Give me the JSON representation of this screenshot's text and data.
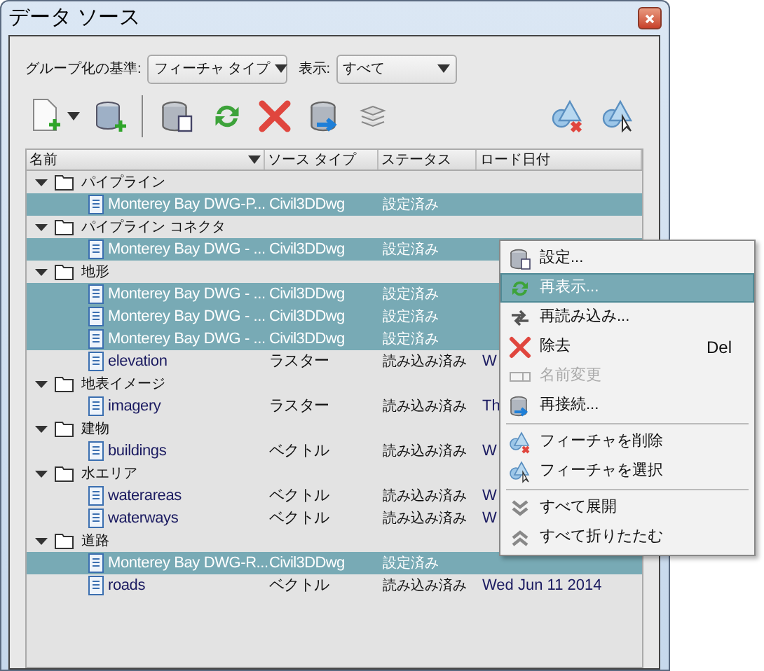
{
  "window": {
    "title": "データ ソース"
  },
  "filters": [
    {
      "label": "グループ化の基準:",
      "value": "フィーチャ タイプ"
    },
    {
      "label": "表示:",
      "value": "すべて"
    }
  ],
  "table": {
    "columns": [
      "名前",
      "ソース タイプ",
      "ステータス",
      "ロード日付"
    ],
    "groups": [
      {
        "name": "パイプライン",
        "expanded": true,
        "children": [
          {
            "name": "Monterey Bay DWG-P...",
            "source_type": "Civil3DDwg",
            "status": "設定済み",
            "selected": true
          }
        ]
      },
      {
        "name": "パイプライン コネクタ",
        "expanded": true,
        "children": [
          {
            "name": "Monterey Bay DWG - ...",
            "source_type": "Civil3DDwg",
            "status": "設定済み",
            "selected": true
          }
        ]
      },
      {
        "name": "地形",
        "expanded": true,
        "children": [
          {
            "name": "Monterey Bay DWG - ...",
            "source_type": "Civil3DDwg",
            "status": "設定済み",
            "selected": true
          },
          {
            "name": "Monterey Bay DWG - ...",
            "source_type": "Civil3DDwg",
            "status": "設定済み",
            "selected": true
          },
          {
            "name": "Monterey Bay DWG - ...",
            "source_type": "Civil3DDwg",
            "status": "設定済み",
            "selected": true
          },
          {
            "name": "elevation",
            "source_type": "ラスター",
            "status": "読み込み済み",
            "date": "W",
            "selected": false
          }
        ]
      },
      {
        "name": "地表イメージ",
        "expanded": true,
        "children": [
          {
            "name": "imagery",
            "source_type": "ラスター",
            "status": "読み込み済み",
            "date": "Th",
            "selected": false
          }
        ]
      },
      {
        "name": "建物",
        "expanded": true,
        "children": [
          {
            "name": "buildings",
            "source_type": "ベクトル",
            "status": "読み込み済み",
            "date": "W",
            "selected": false
          }
        ]
      },
      {
        "name": "水エリア",
        "expanded": true,
        "children": [
          {
            "name": "waterareas",
            "source_type": "ベクトル",
            "status": "読み込み済み",
            "date": "W",
            "selected": false
          },
          {
            "name": "waterways",
            "source_type": "ベクトル",
            "status": "読み込み済み",
            "date": "W",
            "selected": false
          }
        ]
      },
      {
        "name": "道路",
        "expanded": true,
        "children": [
          {
            "name": "Monterey Bay DWG-R...",
            "source_type": "Civil3DDwg",
            "status": "設定済み",
            "selected": true
          },
          {
            "name": "roads",
            "source_type": "ベクトル",
            "status": "読み込み済み",
            "date": "Wed Jun 11 2014",
            "selected": false
          }
        ]
      }
    ]
  },
  "context_menu": [
    {
      "kind": "item",
      "label": "設定...",
      "selected": false,
      "disabled": false
    },
    {
      "kind": "item",
      "label": "再表示...",
      "selected": true,
      "disabled": false
    },
    {
      "kind": "item",
      "label": "再読み込み...",
      "selected": false,
      "disabled": false
    },
    {
      "kind": "item",
      "label": "除去",
      "shortcut": "Del",
      "selected": false,
      "disabled": false
    },
    {
      "kind": "item",
      "label": "名前変更",
      "selected": false,
      "disabled": true
    },
    {
      "kind": "item",
      "label": "再接続...",
      "selected": false,
      "disabled": false
    },
    {
      "kind": "separator"
    },
    {
      "kind": "item",
      "label": "フィーチャを削除",
      "selected": false,
      "disabled": false
    },
    {
      "kind": "item",
      "label": "フィーチャを選択",
      "selected": false,
      "disabled": false
    },
    {
      "kind": "separator"
    },
    {
      "kind": "item",
      "label": "すべて展開",
      "selected": false,
      "disabled": false
    },
    {
      "kind": "item",
      "label": "すべて折りたたむ",
      "selected": false,
      "disabled": false
    }
  ]
}
